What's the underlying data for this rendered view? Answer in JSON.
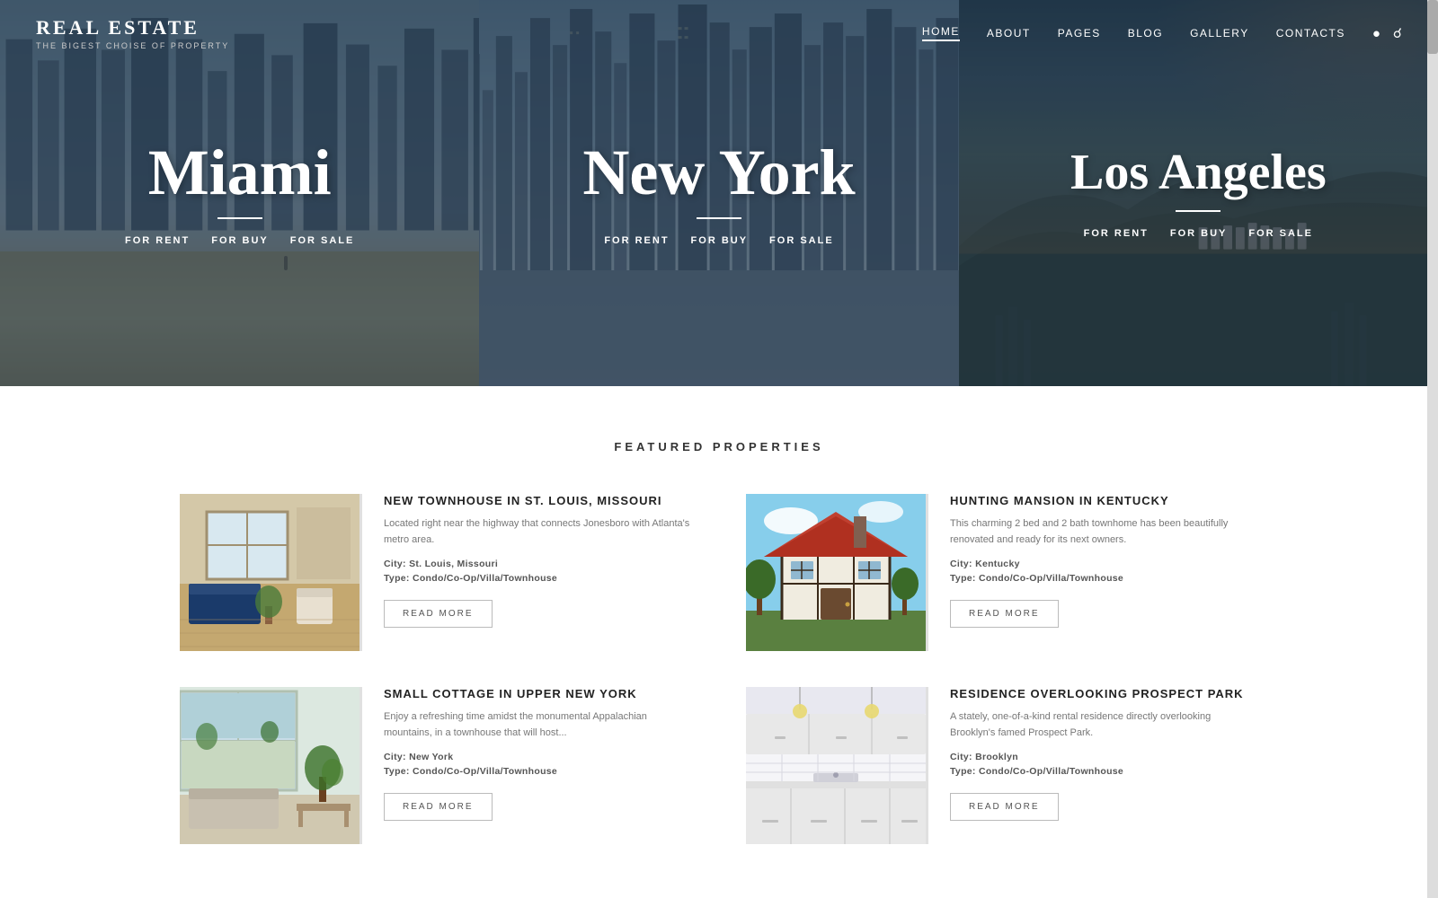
{
  "header": {
    "logo_title": "REAL ESTATE",
    "logo_sub": "THE BIGEST CHOISE OF PROPERTY",
    "nav_items": [
      {
        "label": "HOME",
        "active": true
      },
      {
        "label": "ABOUT",
        "active": false
      },
      {
        "label": "PAGES",
        "active": false
      },
      {
        "label": "BLOG",
        "active": false
      },
      {
        "label": "GALLERY",
        "active": false
      },
      {
        "label": "CONTACTS",
        "active": false
      }
    ]
  },
  "hero": {
    "panels": [
      {
        "city": "Miami",
        "links": [
          "FOR RENT",
          "FOR BUY",
          "FOR SALE"
        ]
      },
      {
        "city": "New York",
        "links": [
          "FOR RENT",
          "FOR BUY",
          "FOR SALE"
        ]
      },
      {
        "city": "Los Angeles",
        "links": [
          "FOR RENT",
          "FOR BUY",
          "FOR SALE"
        ]
      }
    ]
  },
  "featured": {
    "section_title": "FEATURED PROPERTIES",
    "properties": [
      {
        "title": "NEW TOWNHOUSE IN ST. LOUIS, MISSOURI",
        "desc": "Located right near the highway that connects Jonesboro with Atlanta's metro area.",
        "city_label": "City:",
        "city": "St. Louis, Missouri",
        "type_label": "Type:",
        "type": "Condo/Co-Op/Villa/Townhouse",
        "btn": "READ MORE"
      },
      {
        "title": "HUNTING MANSION IN KENTUCKY",
        "desc": "This charming 2 bed and 2 bath townhome has been beautifully renovated and ready for its next owners.",
        "city_label": "City:",
        "city": "Kentucky",
        "type_label": "Type:",
        "type": "Condo/Co-Op/Villa/Townhouse",
        "btn": "READ MORE"
      },
      {
        "title": "SMALL COTTAGE IN UPPER NEW YORK",
        "desc": "Enjoy a refreshing time amidst the monumental Appalachian mountains, in a townhouse that will host...",
        "city_label": "City:",
        "city": "New York",
        "type_label": "Type:",
        "type": "Condo/Co-Op/Villa/Townhouse",
        "btn": "READ MORE"
      },
      {
        "title": "RESIDENCE OVERLOOKING PROSPECT PARK",
        "desc": "A stately, one-of-a-kind rental residence directly overlooking Brooklyn's famed Prospect Park.",
        "city_label": "City:",
        "city": "Brooklyn",
        "type_label": "Type:",
        "type": "Condo/Co-Op/Villa/Townhouse",
        "btn": "READ MORE"
      }
    ]
  }
}
